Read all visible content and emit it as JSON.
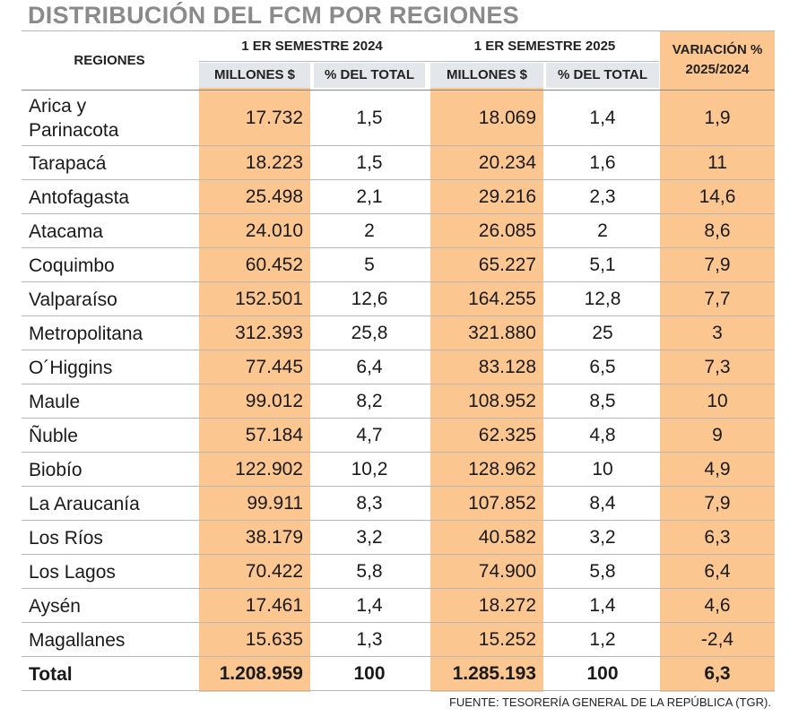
{
  "title": "DISTRIBUCIÓN DEL FCM POR REGIONES",
  "header": {
    "regions": "REGIONES",
    "group_2024": "1 ER SEMESTRE 2024",
    "group_2025": "1 ER SEMESTRE 2025",
    "millions": "MILLONES $",
    "pct_total": "% DEL TOTAL",
    "variation_line1": "VARIACIÓN %",
    "variation_line2": "2025/2024"
  },
  "rows": [
    {
      "region": "Arica y Parinacota",
      "m2024": "17.732",
      "p2024": "1,5",
      "m2025": "18.069",
      "p2025": "1,4",
      "var": "1,9"
    },
    {
      "region": "Tarapacá",
      "m2024": "18.223",
      "p2024": "1,5",
      "m2025": "20.234",
      "p2025": "1,6",
      "var": "11"
    },
    {
      "region": "Antofagasta",
      "m2024": "25.498",
      "p2024": "2,1",
      "m2025": "29.216",
      "p2025": "2,3",
      "var": "14,6"
    },
    {
      "region": "Atacama",
      "m2024": "24.010",
      "p2024": "2",
      "m2025": "26.085",
      "p2025": "2",
      "var": "8,6"
    },
    {
      "region": "Coquimbo",
      "m2024": "60.452",
      "p2024": "5",
      "m2025": "65.227",
      "p2025": "5,1",
      "var": "7,9"
    },
    {
      "region": "Valparaíso",
      "m2024": "152.501",
      "p2024": "12,6",
      "m2025": "164.255",
      "p2025": "12,8",
      "var": "7,7"
    },
    {
      "region": "Metropolitana",
      "m2024": "312.393",
      "p2024": "25,8",
      "m2025": "321.880",
      "p2025": "25",
      "var": "3"
    },
    {
      "region": "O´Higgins",
      "m2024": "77.445",
      "p2024": "6,4",
      "m2025": "83.128",
      "p2025": "6,5",
      "var": "7,3"
    },
    {
      "region": "Maule",
      "m2024": "99.012",
      "p2024": "8,2",
      "m2025": "108.952",
      "p2025": "8,5",
      "var": "10"
    },
    {
      "region": "Ñuble",
      "m2024": "57.184",
      "p2024": "4,7",
      "m2025": "62.325",
      "p2025": "4,8",
      "var": "9"
    },
    {
      "region": "Biobío",
      "m2024": "122.902",
      "p2024": "10,2",
      "m2025": "128.962",
      "p2025": "10",
      "var": "4,9"
    },
    {
      "region": "La Araucanía",
      "m2024": "99.911",
      "p2024": "8,3",
      "m2025": "107.852",
      "p2025": "8,4",
      "var": "7,9"
    },
    {
      "region": "Los Ríos",
      "m2024": "38.179",
      "p2024": "3,2",
      "m2025": "40.582",
      "p2025": "3,2",
      "var": "6,3"
    },
    {
      "region": "Los Lagos",
      "m2024": "70.422",
      "p2024": "5,8",
      "m2025": "74.900",
      "p2025": "5,8",
      "var": "6,4"
    },
    {
      "region": "Aysén",
      "m2024": "17.461",
      "p2024": "1,4",
      "m2025": "18.272",
      "p2025": "1,4",
      "var": "4,6"
    },
    {
      "region": "Magallanes",
      "m2024": "15.635",
      "p2024": "1,3",
      "m2025": "15.252",
      "p2025": "1,2",
      "var": "-2,4"
    }
  ],
  "total": {
    "region": "Total",
    "m2024": "1.208.959",
    "p2024": "100",
    "m2025": "1.285.193",
    "p2025": "100",
    "var": "6,3"
  },
  "source": "FUENTE: TESORERÍA GENERAL DE LA REPÚBLICA (TGR).",
  "colors": {
    "shade": "#fbc68f",
    "subheader": "#e3e6ea",
    "title": "#8a8a8a"
  }
}
